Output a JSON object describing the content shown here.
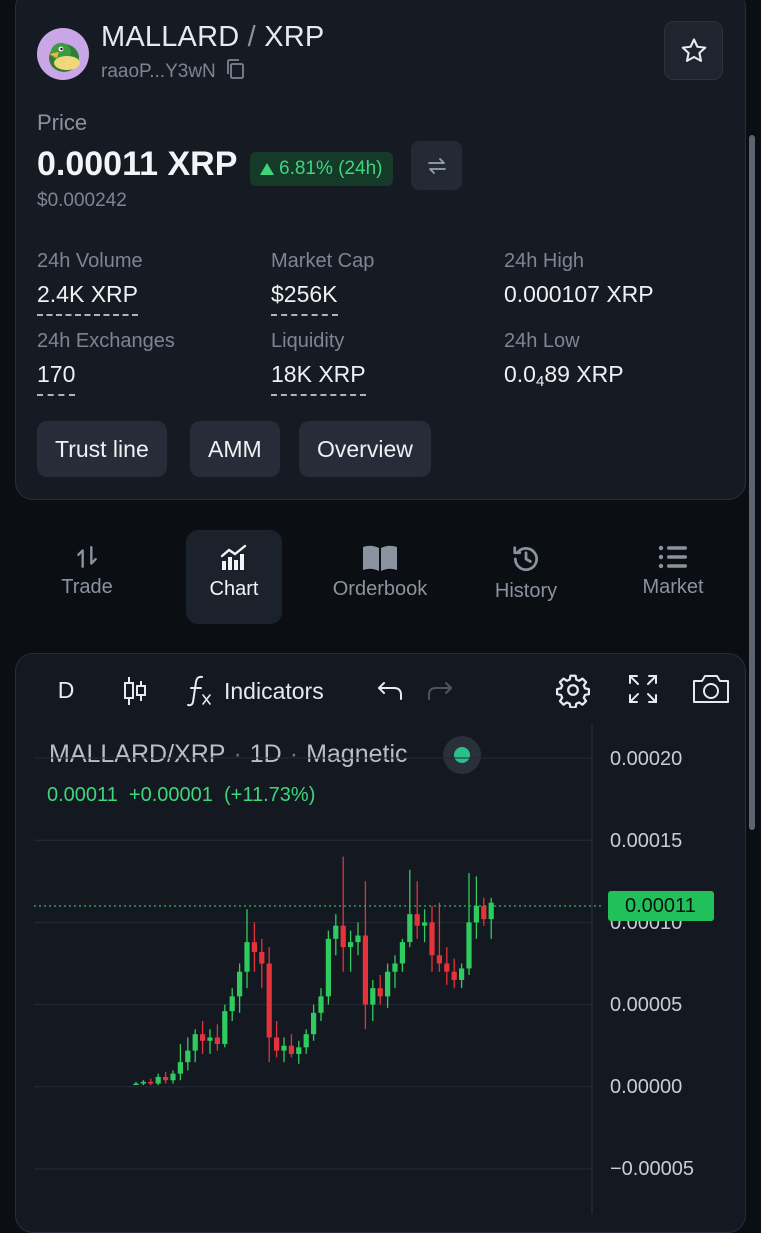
{
  "header": {
    "base": "MALLARD",
    "separator": "/",
    "quote": "XRP",
    "address": "raaoP...Y3wN"
  },
  "price": {
    "label": "Price",
    "value": "0.00011 XRP",
    "change": "6.81% (24h)",
    "usd": "$0.000242",
    "accent_up": "#3ed67a"
  },
  "stats": {
    "volume_label": "24h Volume",
    "volume": "2.4K XRP",
    "mcap_label": "Market Cap",
    "mcap": "$256K",
    "high_label": "24h High",
    "high": "0.000107 XRP",
    "exchanges_label": "24h Exchanges",
    "exchanges": "170",
    "liquidity_label": "Liquidity",
    "liquidity": "18K XRP",
    "low_label": "24h Low",
    "low_prefix": "0.0",
    "low_sub": "4",
    "low_suffix": "89 XRP"
  },
  "chips": [
    "Trust line",
    "AMM",
    "Overview"
  ],
  "tabs": [
    {
      "label": "Trade",
      "icon": "trade-arrows-icon"
    },
    {
      "label": "Chart",
      "icon": "bar-chart-icon",
      "active": true
    },
    {
      "label": "Orderbook",
      "icon": "book-icon"
    },
    {
      "label": "History",
      "icon": "history-icon"
    },
    {
      "label": "Market",
      "icon": "list-icon"
    }
  ],
  "chart_toolbar": {
    "interval": "D",
    "indicators": "Indicators"
  },
  "chart_legend": {
    "symbol": "MALLARD/XRP",
    "interval": "1D",
    "mode": "Magnetic",
    "ohlc": "0.00011  +0.00001  (+11.73%)"
  },
  "chart_data": {
    "type": "candlestick",
    "title": "MALLARD/XRP",
    "y_ticks": [
      "0.00020",
      "0.00015",
      "0.00010",
      "0.00005",
      "0.00000",
      "−0.00005"
    ],
    "ylim": [
      -5e-05,
      0.0002
    ],
    "last_price": "0.00011",
    "last_price_value": 0.00011,
    "up_color": "#2ecc5e",
    "down_color": "#e5323b",
    "candles": [
      {
        "o": 2e-06,
        "h": 3e-06,
        "l": 1e-06,
        "c": 2e-06
      },
      {
        "o": 2e-06,
        "h": 4e-06,
        "l": 1e-06,
        "c": 3e-06
      },
      {
        "o": 3e-06,
        "h": 5e-06,
        "l": 1e-06,
        "c": 2e-06
      },
      {
        "o": 2e-06,
        "h": 8e-06,
        "l": 1e-06,
        "c": 6e-06
      },
      {
        "o": 6e-06,
        "h": 9e-06,
        "l": 2e-06,
        "c": 4e-06
      },
      {
        "o": 4e-06,
        "h": 1e-05,
        "l": 2e-06,
        "c": 8e-06
      },
      {
        "o": 8e-06,
        "h": 2.6e-05,
        "l": 4e-06,
        "c": 1.5e-05
      },
      {
        "o": 1.5e-05,
        "h": 3e-05,
        "l": 1e-05,
        "c": 2.2e-05
      },
      {
        "o": 2.2e-05,
        "h": 3.5e-05,
        "l": 1.5e-05,
        "c": 3.2e-05
      },
      {
        "o": 3.2e-05,
        "h": 4e-05,
        "l": 2e-05,
        "c": 2.8e-05
      },
      {
        "o": 2.8e-05,
        "h": 3.5e-05,
        "l": 2e-05,
        "c": 3e-05
      },
      {
        "o": 3e-05,
        "h": 3.8e-05,
        "l": 2.2e-05,
        "c": 2.6e-05
      },
      {
        "o": 2.6e-05,
        "h": 5e-05,
        "l": 2.4e-05,
        "c": 4.6e-05
      },
      {
        "o": 4.6e-05,
        "h": 6e-05,
        "l": 4e-05,
        "c": 5.5e-05
      },
      {
        "o": 5.5e-05,
        "h": 7.5e-05,
        "l": 4.5e-05,
        "c": 7e-05
      },
      {
        "o": 7e-05,
        "h": 0.000108,
        "l": 6e-05,
        "c": 8.8e-05
      },
      {
        "o": 8.8e-05,
        "h": 0.0001,
        "l": 7e-05,
        "c": 8.2e-05
      },
      {
        "o": 8.2e-05,
        "h": 9e-05,
        "l": 6e-05,
        "c": 7.5e-05
      },
      {
        "o": 7.5e-05,
        "h": 8.5e-05,
        "l": 1.5e-05,
        "c": 3e-05
      },
      {
        "o": 3e-05,
        "h": 4e-05,
        "l": 1.8e-05,
        "c": 2.2e-05
      },
      {
        "o": 2.2e-05,
        "h": 3e-05,
        "l": 1.5e-05,
        "c": 2.5e-05
      },
      {
        "o": 2.5e-05,
        "h": 3.2e-05,
        "l": 1.8e-05,
        "c": 2e-05
      },
      {
        "o": 2e-05,
        "h": 2.8e-05,
        "l": 1.4e-05,
        "c": 2.4e-05
      },
      {
        "o": 2.4e-05,
        "h": 3.5e-05,
        "l": 2e-05,
        "c": 3.2e-05
      },
      {
        "o": 3.2e-05,
        "h": 5e-05,
        "l": 2.8e-05,
        "c": 4.5e-05
      },
      {
        "o": 4.5e-05,
        "h": 6e-05,
        "l": 4e-05,
        "c": 5.5e-05
      },
      {
        "o": 5.5e-05,
        "h": 9.5e-05,
        "l": 5e-05,
        "c": 9e-05
      },
      {
        "o": 9e-05,
        "h": 0.000105,
        "l": 8e-05,
        "c": 9.8e-05
      },
      {
        "o": 9.8e-05,
        "h": 0.00014,
        "l": 7e-05,
        "c": 8.5e-05
      },
      {
        "o": 8.5e-05,
        "h": 9.5e-05,
        "l": 7e-05,
        "c": 8.8e-05
      },
      {
        "o": 8.8e-05,
        "h": 0.0001,
        "l": 8e-05,
        "c": 9.2e-05
      },
      {
        "o": 9.2e-05,
        "h": 0.000125,
        "l": 3.5e-05,
        "c": 5e-05
      },
      {
        "o": 5e-05,
        "h": 6.5e-05,
        "l": 4e-05,
        "c": 6e-05
      },
      {
        "o": 6e-05,
        "h": 6.8e-05,
        "l": 5e-05,
        "c": 5.5e-05
      },
      {
        "o": 5.5e-05,
        "h": 7.5e-05,
        "l": 4.8e-05,
        "c": 7e-05
      },
      {
        "o": 7e-05,
        "h": 8e-05,
        "l": 6e-05,
        "c": 7.5e-05
      },
      {
        "o": 7.5e-05,
        "h": 9e-05,
        "l": 7e-05,
        "c": 8.8e-05
      },
      {
        "o": 8.8e-05,
        "h": 0.000132,
        "l": 8.5e-05,
        "c": 0.000105
      },
      {
        "o": 0.000105,
        "h": 0.000125,
        "l": 9e-05,
        "c": 9.8e-05
      },
      {
        "o": 9.8e-05,
        "h": 0.000108,
        "l": 8.8e-05,
        "c": 0.0001
      },
      {
        "o": 0.0001,
        "h": 0.00011,
        "l": 7e-05,
        "c": 8e-05
      },
      {
        "o": 8e-05,
        "h": 0.000112,
        "l": 7e-05,
        "c": 7.5e-05
      },
      {
        "o": 7.5e-05,
        "h": 8.5e-05,
        "l": 6.2e-05,
        "c": 7e-05
      },
      {
        "o": 7e-05,
        "h": 7.8e-05,
        "l": 6e-05,
        "c": 6.5e-05
      },
      {
        "o": 6.5e-05,
        "h": 7.5e-05,
        "l": 6e-05,
        "c": 7.2e-05
      },
      {
        "o": 7.2e-05,
        "h": 0.00013,
        "l": 6.8e-05,
        "c": 0.0001
      },
      {
        "o": 0.0001,
        "h": 0.000128,
        "l": 9e-05,
        "c": 0.00011
      },
      {
        "o": 0.00011,
        "h": 0.000115,
        "l": 9.8e-05,
        "c": 0.000102
      },
      {
        "o": 0.000102,
        "h": 0.000115,
        "l": 9e-05,
        "c": 0.000112
      }
    ]
  }
}
